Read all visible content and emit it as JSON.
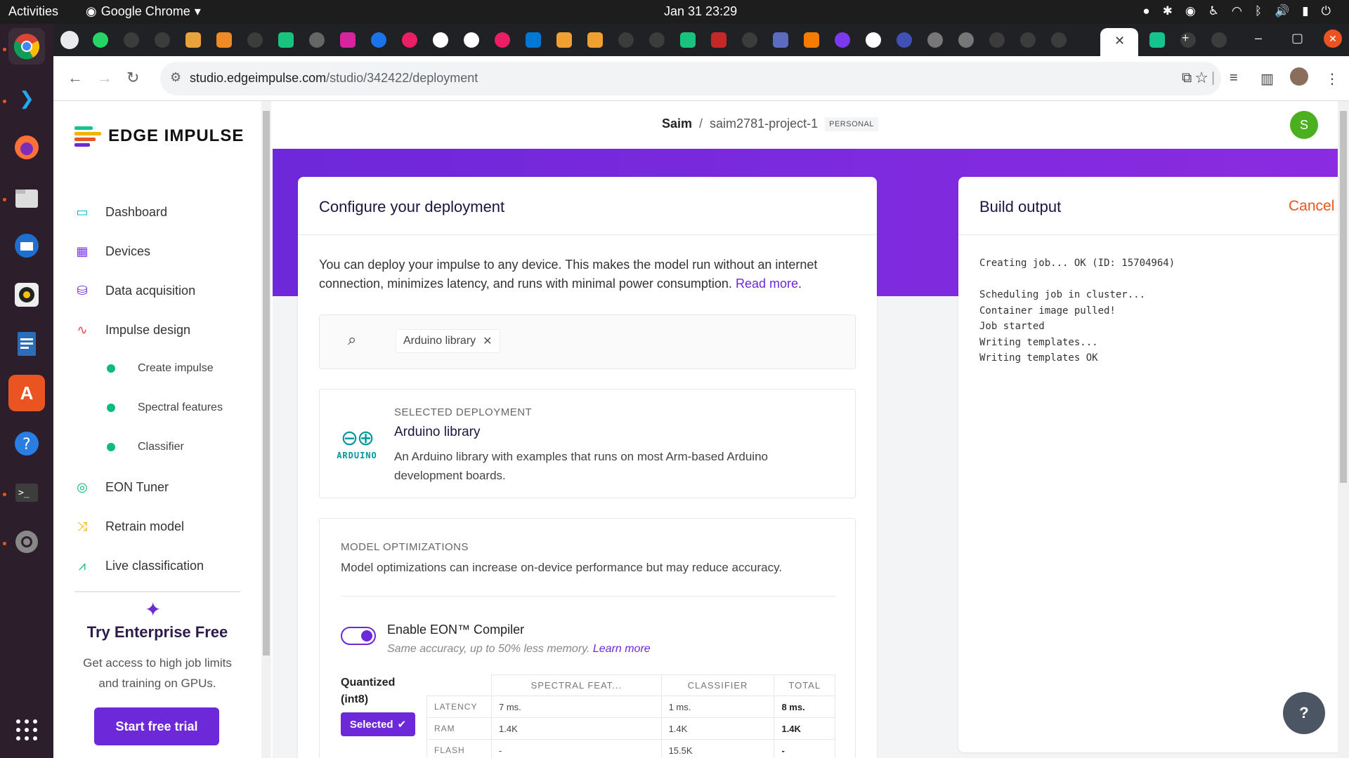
{
  "os": {
    "activities": "Activities",
    "app_name": "Google Chrome",
    "clock": "Jan 31  23:29"
  },
  "browser": {
    "url_host": "studio.edgeimpulse.com",
    "url_path": "/studio/342422/deployment"
  },
  "sidebar": {
    "logo_text": "EDGE IMPULSE",
    "items": [
      {
        "label": "Dashboard",
        "icon": "monitor-icon",
        "color": "#06b6d4"
      },
      {
        "label": "Devices",
        "icon": "chip-icon",
        "color": "#7c3aed"
      },
      {
        "label": "Data acquisition",
        "icon": "database-icon",
        "color": "#6d28d9"
      },
      {
        "label": "Impulse design",
        "icon": "pulse-icon",
        "color": "#ef4444"
      }
    ],
    "sub_items": [
      {
        "label": "Create impulse"
      },
      {
        "label": "Spectral features"
      },
      {
        "label": "Classifier"
      }
    ],
    "items2": [
      {
        "label": "EON Tuner",
        "icon": "compass-icon",
        "color": "#10b981"
      },
      {
        "label": "Retrain model",
        "icon": "shuffle-icon",
        "color": "#eab308"
      },
      {
        "label": "Live classification",
        "icon": "network-icon",
        "color": "#10b981"
      }
    ],
    "promo": {
      "title": "Try Enterprise Free",
      "text": "Get access to high job limits and training on GPUs.",
      "button": "Start free trial"
    }
  },
  "header": {
    "user": "Saim",
    "separator": "/",
    "project": "saim2781-project-1",
    "badge": "PERSONAL",
    "avatar": "S"
  },
  "configure": {
    "title": "Configure your deployment",
    "intro": "You can deploy your impulse to any device. This makes the model run without an internet connection, minimizes latency, and runs with minimal power consumption.",
    "read_more": "Read more",
    "search_chip": "Arduino library",
    "selected_label": "SELECTED DEPLOYMENT",
    "selected_name": "Arduino library",
    "selected_desc": "An Arduino library with examples that runs on most Arm-based Arduino development boards.",
    "arduino_logo_text": "ARDUINO",
    "optim_label": "MODEL OPTIMIZATIONS",
    "optim_desc": "Model optimizations can increase on-device performance but may reduce accuracy.",
    "eon_title": "Enable EON™ Compiler",
    "eon_sub": "Same accuracy, up to 50% less memory.",
    "eon_learn": "Learn more",
    "eon_enabled": true,
    "quantized_line1": "Quantized",
    "quantized_line2": "(int8)",
    "selected_button": "Selected",
    "table": {
      "headers": [
        "SPECTRAL FEAT...",
        "CLASSIFIER",
        "TOTAL"
      ],
      "rows": [
        {
          "label": "LATENCY",
          "values": [
            "7 ms.",
            "1 ms.",
            "8 ms."
          ]
        },
        {
          "label": "RAM",
          "values": [
            "1.4K",
            "1.4K",
            "1.4K"
          ]
        },
        {
          "label": "FLASH",
          "values": [
            "-",
            "15.5K",
            "-"
          ]
        }
      ]
    }
  },
  "build": {
    "title": "Build output",
    "cancel": "Cancel",
    "log": "Creating job... OK (ID: 15704964)\n\nScheduling job in cluster...\nContainer image pulled!\nJob started\nWriting templates...\nWriting templates OK"
  },
  "colors": {
    "accent": "#6d28d9",
    "cancel": "#e8551f",
    "success": "#10b981"
  }
}
